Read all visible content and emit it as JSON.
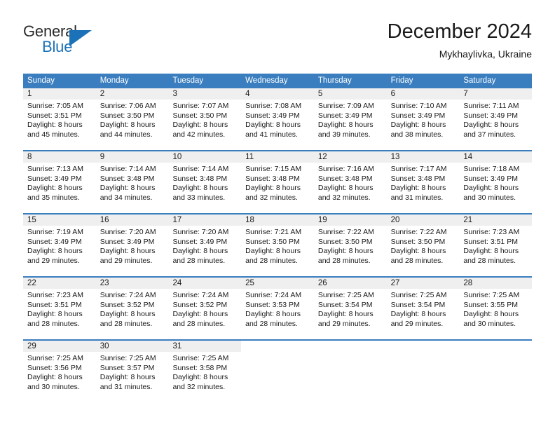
{
  "brand": {
    "line1": "General",
    "line2": "Blue",
    "logo_icon": "blue-triangle-icon",
    "accent_color": "#1b72b8"
  },
  "header": {
    "title": "December 2024",
    "subtitle": "Mykhaylivka, Ukraine"
  },
  "calendar": {
    "header_background": "#3a7ebf",
    "day_number_background": "#efefef",
    "weekdays": [
      "Sunday",
      "Monday",
      "Tuesday",
      "Wednesday",
      "Thursday",
      "Friday",
      "Saturday"
    ],
    "weeks": [
      [
        {
          "day": "1",
          "sunrise": "Sunrise: 7:05 AM",
          "sunset": "Sunset: 3:51 PM",
          "daylight1": "Daylight: 8 hours",
          "daylight2": "and 45 minutes."
        },
        {
          "day": "2",
          "sunrise": "Sunrise: 7:06 AM",
          "sunset": "Sunset: 3:50 PM",
          "daylight1": "Daylight: 8 hours",
          "daylight2": "and 44 minutes."
        },
        {
          "day": "3",
          "sunrise": "Sunrise: 7:07 AM",
          "sunset": "Sunset: 3:50 PM",
          "daylight1": "Daylight: 8 hours",
          "daylight2": "and 42 minutes."
        },
        {
          "day": "4",
          "sunrise": "Sunrise: 7:08 AM",
          "sunset": "Sunset: 3:49 PM",
          "daylight1": "Daylight: 8 hours",
          "daylight2": "and 41 minutes."
        },
        {
          "day": "5",
          "sunrise": "Sunrise: 7:09 AM",
          "sunset": "Sunset: 3:49 PM",
          "daylight1": "Daylight: 8 hours",
          "daylight2": "and 39 minutes."
        },
        {
          "day": "6",
          "sunrise": "Sunrise: 7:10 AM",
          "sunset": "Sunset: 3:49 PM",
          "daylight1": "Daylight: 8 hours",
          "daylight2": "and 38 minutes."
        },
        {
          "day": "7",
          "sunrise": "Sunrise: 7:11 AM",
          "sunset": "Sunset: 3:49 PM",
          "daylight1": "Daylight: 8 hours",
          "daylight2": "and 37 minutes."
        }
      ],
      [
        {
          "day": "8",
          "sunrise": "Sunrise: 7:13 AM",
          "sunset": "Sunset: 3:49 PM",
          "daylight1": "Daylight: 8 hours",
          "daylight2": "and 35 minutes."
        },
        {
          "day": "9",
          "sunrise": "Sunrise: 7:14 AM",
          "sunset": "Sunset: 3:48 PM",
          "daylight1": "Daylight: 8 hours",
          "daylight2": "and 34 minutes."
        },
        {
          "day": "10",
          "sunrise": "Sunrise: 7:14 AM",
          "sunset": "Sunset: 3:48 PM",
          "daylight1": "Daylight: 8 hours",
          "daylight2": "and 33 minutes."
        },
        {
          "day": "11",
          "sunrise": "Sunrise: 7:15 AM",
          "sunset": "Sunset: 3:48 PM",
          "daylight1": "Daylight: 8 hours",
          "daylight2": "and 32 minutes."
        },
        {
          "day": "12",
          "sunrise": "Sunrise: 7:16 AM",
          "sunset": "Sunset: 3:48 PM",
          "daylight1": "Daylight: 8 hours",
          "daylight2": "and 32 minutes."
        },
        {
          "day": "13",
          "sunrise": "Sunrise: 7:17 AM",
          "sunset": "Sunset: 3:48 PM",
          "daylight1": "Daylight: 8 hours",
          "daylight2": "and 31 minutes."
        },
        {
          "day": "14",
          "sunrise": "Sunrise: 7:18 AM",
          "sunset": "Sunset: 3:49 PM",
          "daylight1": "Daylight: 8 hours",
          "daylight2": "and 30 minutes."
        }
      ],
      [
        {
          "day": "15",
          "sunrise": "Sunrise: 7:19 AM",
          "sunset": "Sunset: 3:49 PM",
          "daylight1": "Daylight: 8 hours",
          "daylight2": "and 29 minutes."
        },
        {
          "day": "16",
          "sunrise": "Sunrise: 7:20 AM",
          "sunset": "Sunset: 3:49 PM",
          "daylight1": "Daylight: 8 hours",
          "daylight2": "and 29 minutes."
        },
        {
          "day": "17",
          "sunrise": "Sunrise: 7:20 AM",
          "sunset": "Sunset: 3:49 PM",
          "daylight1": "Daylight: 8 hours",
          "daylight2": "and 28 minutes."
        },
        {
          "day": "18",
          "sunrise": "Sunrise: 7:21 AM",
          "sunset": "Sunset: 3:50 PM",
          "daylight1": "Daylight: 8 hours",
          "daylight2": "and 28 minutes."
        },
        {
          "day": "19",
          "sunrise": "Sunrise: 7:22 AM",
          "sunset": "Sunset: 3:50 PM",
          "daylight1": "Daylight: 8 hours",
          "daylight2": "and 28 minutes."
        },
        {
          "day": "20",
          "sunrise": "Sunrise: 7:22 AM",
          "sunset": "Sunset: 3:50 PM",
          "daylight1": "Daylight: 8 hours",
          "daylight2": "and 28 minutes."
        },
        {
          "day": "21",
          "sunrise": "Sunrise: 7:23 AM",
          "sunset": "Sunset: 3:51 PM",
          "daylight1": "Daylight: 8 hours",
          "daylight2": "and 28 minutes."
        }
      ],
      [
        {
          "day": "22",
          "sunrise": "Sunrise: 7:23 AM",
          "sunset": "Sunset: 3:51 PM",
          "daylight1": "Daylight: 8 hours",
          "daylight2": "and 28 minutes."
        },
        {
          "day": "23",
          "sunrise": "Sunrise: 7:24 AM",
          "sunset": "Sunset: 3:52 PM",
          "daylight1": "Daylight: 8 hours",
          "daylight2": "and 28 minutes."
        },
        {
          "day": "24",
          "sunrise": "Sunrise: 7:24 AM",
          "sunset": "Sunset: 3:52 PM",
          "daylight1": "Daylight: 8 hours",
          "daylight2": "and 28 minutes."
        },
        {
          "day": "25",
          "sunrise": "Sunrise: 7:24 AM",
          "sunset": "Sunset: 3:53 PM",
          "daylight1": "Daylight: 8 hours",
          "daylight2": "and 28 minutes."
        },
        {
          "day": "26",
          "sunrise": "Sunrise: 7:25 AM",
          "sunset": "Sunset: 3:54 PM",
          "daylight1": "Daylight: 8 hours",
          "daylight2": "and 29 minutes."
        },
        {
          "day": "27",
          "sunrise": "Sunrise: 7:25 AM",
          "sunset": "Sunset: 3:54 PM",
          "daylight1": "Daylight: 8 hours",
          "daylight2": "and 29 minutes."
        },
        {
          "day": "28",
          "sunrise": "Sunrise: 7:25 AM",
          "sunset": "Sunset: 3:55 PM",
          "daylight1": "Daylight: 8 hours",
          "daylight2": "and 30 minutes."
        }
      ],
      [
        {
          "day": "29",
          "sunrise": "Sunrise: 7:25 AM",
          "sunset": "Sunset: 3:56 PM",
          "daylight1": "Daylight: 8 hours",
          "daylight2": "and 30 minutes."
        },
        {
          "day": "30",
          "sunrise": "Sunrise: 7:25 AM",
          "sunset": "Sunset: 3:57 PM",
          "daylight1": "Daylight: 8 hours",
          "daylight2": "and 31 minutes."
        },
        {
          "day": "31",
          "sunrise": "Sunrise: 7:25 AM",
          "sunset": "Sunset: 3:58 PM",
          "daylight1": "Daylight: 8 hours",
          "daylight2": "and 32 minutes."
        },
        {
          "day": "",
          "sunrise": "",
          "sunset": "",
          "daylight1": "",
          "daylight2": ""
        },
        {
          "day": "",
          "sunrise": "",
          "sunset": "",
          "daylight1": "",
          "daylight2": ""
        },
        {
          "day": "",
          "sunrise": "",
          "sunset": "",
          "daylight1": "",
          "daylight2": ""
        },
        {
          "day": "",
          "sunrise": "",
          "sunset": "",
          "daylight1": "",
          "daylight2": ""
        }
      ]
    ]
  }
}
